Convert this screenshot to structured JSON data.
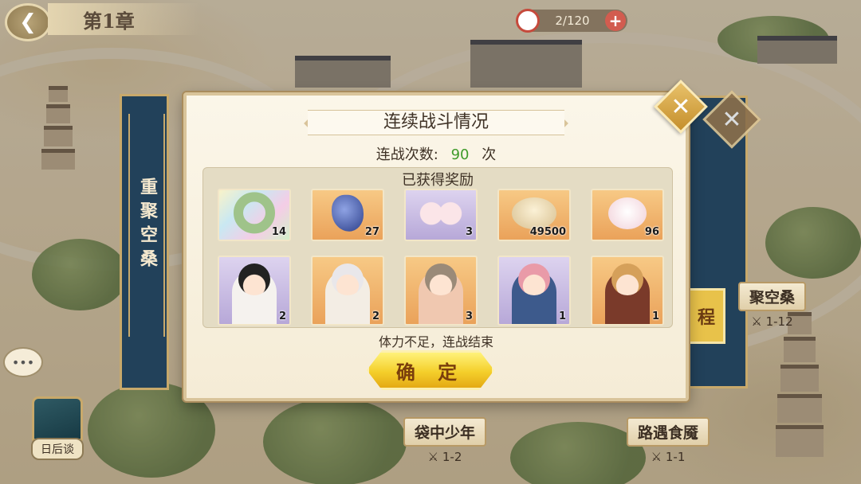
{
  "header": {
    "back_icon": "back-arrow-icon",
    "chapter": "第1章"
  },
  "stamina": {
    "value": "2/120",
    "plus_icon": "plus-icon"
  },
  "side_scroll": {
    "left_title": "重聚空桑"
  },
  "map_nodes": [
    {
      "name": "袋中少年",
      "stage": "1-2"
    },
    {
      "name": "路遇食魇",
      "stage": "1-1"
    },
    {
      "name": "聚空桑",
      "stage": "1-12"
    }
  ],
  "journey_button": "程",
  "bottom_menu": {
    "label": "日后谈"
  },
  "modal": {
    "title": "连续战斗情况",
    "count_label": "连战次数:",
    "count_value": "90",
    "count_unit": "次",
    "rewards_header": "已获得奖励",
    "items": [
      {
        "icon": "jade-ring-icon",
        "count": "14",
        "color": "rainbow"
      },
      {
        "icon": "blue-crystal-icon",
        "count": "27",
        "color": "orange"
      },
      {
        "icon": "bun-pair-icon",
        "count": "3",
        "color": "purple"
      },
      {
        "icon": "shell-coin-icon",
        "count": "49500",
        "color": "orange"
      },
      {
        "icon": "rabbit-bun-icon",
        "count": "96",
        "color": "orange"
      }
    ],
    "characters": [
      {
        "icon": "character-black-hair-icon",
        "count": "2",
        "color": "purple"
      },
      {
        "icon": "character-white-hair-icon",
        "count": "2",
        "color": "orange"
      },
      {
        "icon": "character-green-eyes-icon",
        "count": "3",
        "color": "orange"
      },
      {
        "icon": "character-pink-hair-icon",
        "count": "1",
        "color": "purple"
      },
      {
        "icon": "character-blond-hair-icon",
        "count": "1",
        "color": "orange"
      }
    ],
    "status": "体力不足，连战结束",
    "confirm": "确 定",
    "close_icon": "close-icon"
  }
}
